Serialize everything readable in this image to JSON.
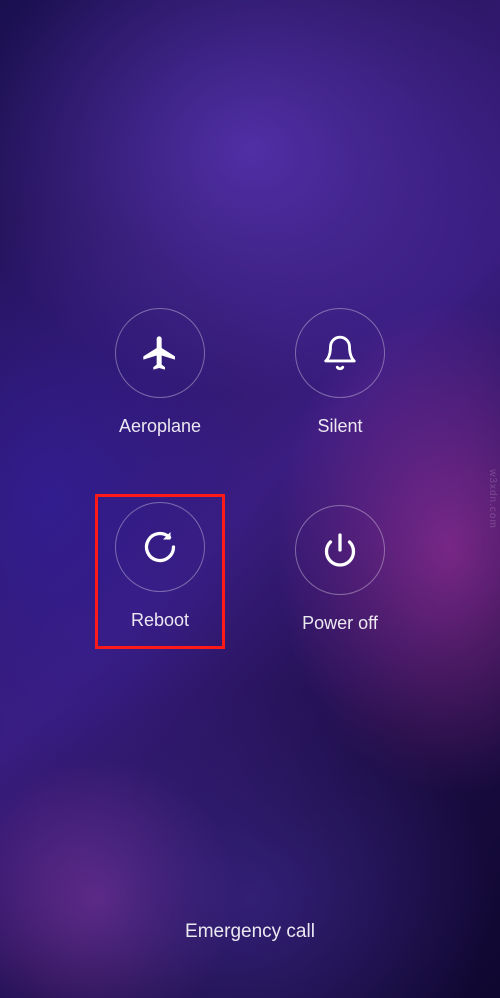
{
  "options": {
    "aeroplane": {
      "label": "Aeroplane"
    },
    "silent": {
      "label": "Silent"
    },
    "reboot": {
      "label": "Reboot"
    },
    "poweroff": {
      "label": "Power off"
    }
  },
  "emergency_label": "Emergency call",
  "watermark": "w3xdn.com"
}
